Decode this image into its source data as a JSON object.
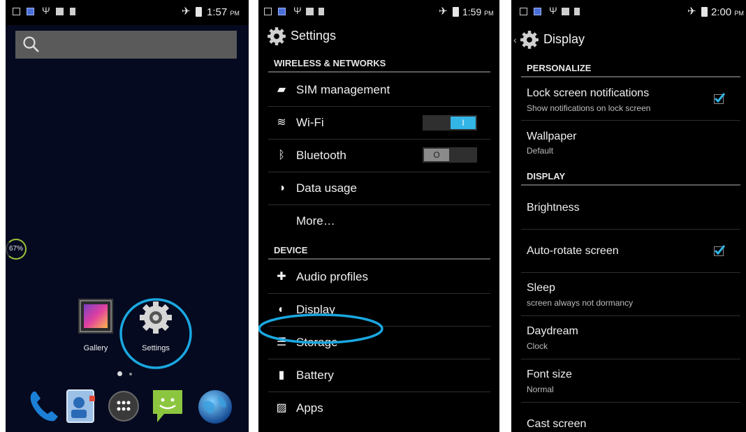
{
  "home": {
    "status": {
      "time": "1:57",
      "ampm": "PM"
    },
    "battery_widget": "67%",
    "apps": [
      {
        "label": "Gallery"
      },
      {
        "label": "Settings"
      }
    ],
    "dock_icons": [
      "phone-icon",
      "contacts-icon",
      "app-drawer-icon",
      "messaging-icon",
      "browser-icon"
    ],
    "highlight_color": "#1aa7e0"
  },
  "settings": {
    "status": {
      "time": "1:59",
      "ampm": "PM"
    },
    "title": "Settings",
    "sections": [
      {
        "header": "WIRELESS & NETWORKS",
        "items": [
          {
            "label": "SIM management",
            "icon": "sim-icon"
          },
          {
            "label": "Wi-Fi",
            "icon": "wifi-icon",
            "toggle": "on",
            "toggle_text": "I"
          },
          {
            "label": "Bluetooth",
            "icon": "bluetooth-icon",
            "toggle": "off",
            "toggle_text": "O"
          },
          {
            "label": "Data usage",
            "icon": "data-usage-icon"
          },
          {
            "label": "More…",
            "icon": ""
          }
        ]
      },
      {
        "header": "DEVICE",
        "items": [
          {
            "label": "Audio profiles",
            "icon": "audio-icon"
          },
          {
            "label": "Display",
            "icon": "display-icon"
          },
          {
            "label": "Storage",
            "icon": "storage-icon"
          },
          {
            "label": "Battery",
            "icon": "battery-icon"
          },
          {
            "label": "Apps",
            "icon": "apps-icon"
          }
        ]
      }
    ],
    "toggle_on_color": "#33b5e5"
  },
  "display": {
    "status": {
      "time": "2:00",
      "ampm": "PM"
    },
    "title": "Display",
    "sections": [
      {
        "header": "PERSONALIZE",
        "items": [
          {
            "label": "Lock screen notifications",
            "summary": "Show notifications on lock screen",
            "checked": true
          },
          {
            "label": "Wallpaper",
            "summary": "Default"
          }
        ]
      },
      {
        "header": "DISPLAY",
        "items": [
          {
            "label": "Brightness"
          },
          {
            "label": "Auto-rotate screen",
            "checked": true
          },
          {
            "label": "Sleep",
            "summary": "screen always not dormancy"
          },
          {
            "label": "Daydream",
            "summary": "Clock"
          },
          {
            "label": "Font size",
            "summary": "Normal"
          },
          {
            "label": "Cast screen"
          }
        ]
      }
    ],
    "check_color": "#33b5e5"
  }
}
